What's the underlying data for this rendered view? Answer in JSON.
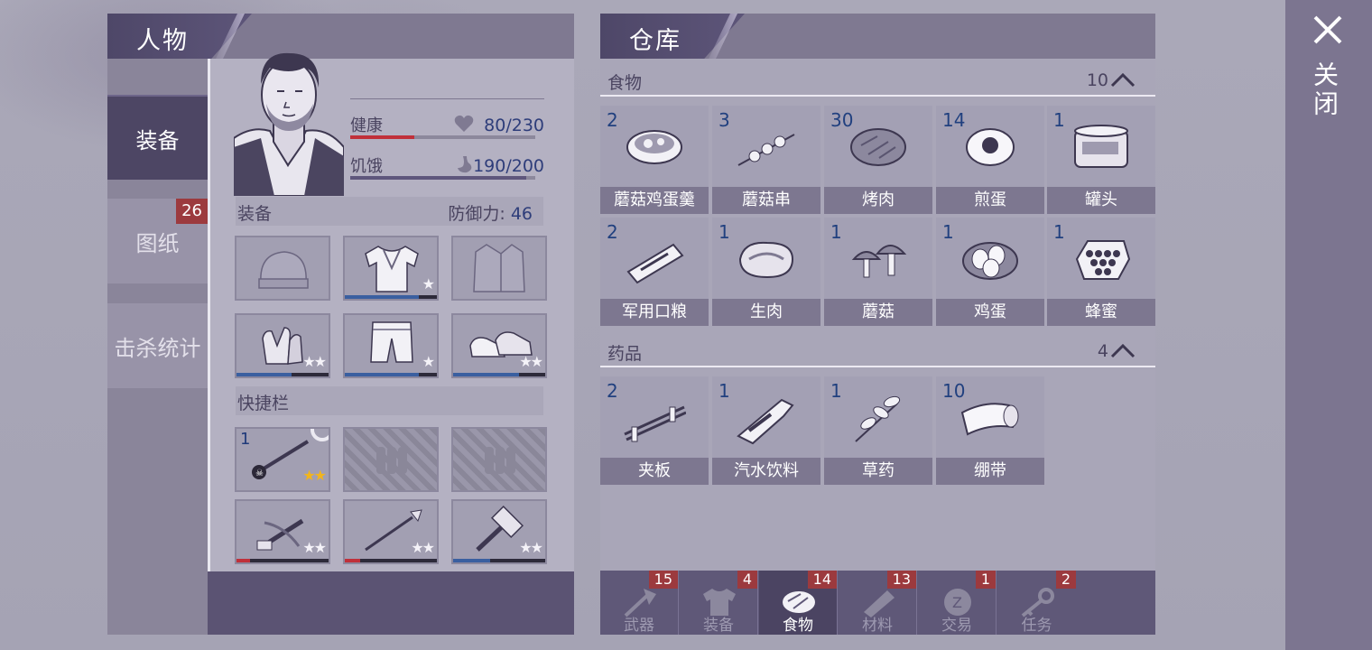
{
  "character": {
    "title": "人物",
    "side_tabs": [
      {
        "label": "装备",
        "active": true,
        "badge": ""
      },
      {
        "label": "图纸",
        "active": false,
        "badge": "26"
      },
      {
        "label": "击杀统计",
        "active": false,
        "badge": ""
      }
    ],
    "stats": {
      "health": {
        "label": "健康",
        "value": "80/230",
        "fraction": 0.348,
        "color": "#c0303a",
        "icon": "heart-icon"
      },
      "hunger": {
        "label": "饥饿",
        "value": "190/200",
        "fraction": 0.95,
        "color": "#5e567c",
        "icon": "stomach-icon"
      }
    },
    "equipment": {
      "label": "装备",
      "defense_label": "防御力:",
      "defense_value": "46",
      "slots": [
        {
          "name": "helmet-slot",
          "icon": "beanie-icon",
          "stars": "",
          "durability": null
        },
        {
          "name": "shirt-slot",
          "icon": "shirt-icon",
          "stars": "★",
          "durability": 0.8
        },
        {
          "name": "jacket-slot",
          "icon": "jacket-icon",
          "stars": "",
          "durability": null
        },
        {
          "name": "gloves-slot",
          "icon": "gloves-icon",
          "stars": "★★",
          "durability": 0.6
        },
        {
          "name": "pants-slot",
          "icon": "pants-icon",
          "stars": "★",
          "durability": 0.8
        },
        {
          "name": "shoes-slot",
          "icon": "shoes-icon",
          "stars": "★★",
          "durability": 0.72
        }
      ]
    },
    "quickbar": {
      "label": "快捷栏",
      "slots": [
        {
          "name": "weapon-slot-mace",
          "count": "1",
          "icon": "mace-icon",
          "stars": "★★",
          "gold": true,
          "locked": false
        },
        {
          "name": "locked-slot-1",
          "icon": "ammo-icon",
          "locked": true
        },
        {
          "name": "locked-slot-2",
          "icon": "ammo-icon",
          "locked": true
        },
        {
          "name": "weapon-slot-crossbow",
          "icon": "crossbow-icon",
          "stars": "★★",
          "durability": 0.15,
          "dura_color": "#c0303a",
          "locked": false
        },
        {
          "name": "weapon-slot-spear",
          "icon": "spear-icon",
          "stars": "★★",
          "durability": 0.17,
          "dura_color": "#c0303a",
          "locked": false
        },
        {
          "name": "weapon-slot-hammer",
          "icon": "hammer-icon",
          "stars": "★★",
          "durability": 0.4,
          "dura_color": "#3a5fa0",
          "locked": false
        }
      ]
    }
  },
  "warehouse": {
    "title": "仓库",
    "categories": [
      {
        "label": "食物",
        "count": "10",
        "items": [
          {
            "count": "2",
            "name": "蘑菇鸡蛋羹",
            "icon": "bowl-icon"
          },
          {
            "count": "3",
            "name": "蘑菇串",
            "icon": "skewer-icon"
          },
          {
            "count": "30",
            "name": "烤肉",
            "icon": "roast-meat-icon"
          },
          {
            "count": "14",
            "name": "煎蛋",
            "icon": "fried-egg-icon"
          },
          {
            "count": "1",
            "name": "罐头",
            "icon": "can-icon"
          },
          {
            "count": "2",
            "name": "军用口粮",
            "icon": "ration-icon"
          },
          {
            "count": "1",
            "name": "生肉",
            "icon": "raw-meat-icon"
          },
          {
            "count": "1",
            "name": "蘑菇",
            "icon": "mushroom-icon"
          },
          {
            "count": "1",
            "name": "鸡蛋",
            "icon": "eggs-icon"
          },
          {
            "count": "1",
            "name": "蜂蜜",
            "icon": "honeycomb-icon"
          }
        ]
      },
      {
        "label": "药品",
        "count": "4",
        "items": [
          {
            "count": "2",
            "name": "夹板",
            "icon": "splint-icon"
          },
          {
            "count": "1",
            "name": "汽水饮料",
            "icon": "soda-icon"
          },
          {
            "count": "1",
            "name": "草药",
            "icon": "herb-icon"
          },
          {
            "count": "10",
            "name": "绷带",
            "icon": "bandage-icon"
          }
        ]
      }
    ],
    "bottom_tabs": [
      {
        "label": "武器",
        "badge": "15",
        "icon": "axe-icon",
        "active": false
      },
      {
        "label": "装备",
        "badge": "4",
        "icon": "shirt-icon",
        "active": false
      },
      {
        "label": "食物",
        "badge": "14",
        "icon": "meat-icon",
        "active": true
      },
      {
        "label": "材料",
        "badge": "13",
        "icon": "log-icon",
        "active": false
      },
      {
        "label": "交易",
        "badge": "1",
        "icon": "coin-icon",
        "active": false
      },
      {
        "label": "任务",
        "badge": "2",
        "icon": "key-icon",
        "active": false
      }
    ]
  },
  "close": {
    "label": "关闭",
    "icon": "close-icon"
  }
}
